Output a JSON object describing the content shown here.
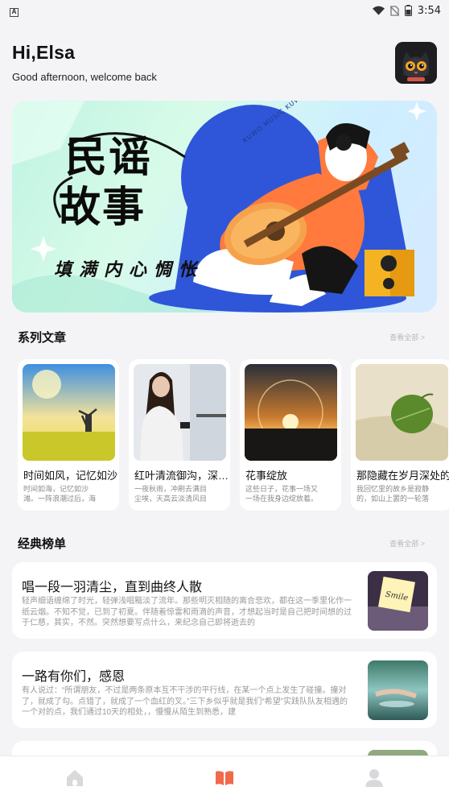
{
  "status_bar": {
    "time": "3:54",
    "notification_icon": "A"
  },
  "header": {
    "greeting": "Hi,Elsa",
    "subtitle": "Good afternoon, welcome back",
    "avatar_icon": "cat-avatar-icon"
  },
  "banner": {
    "title_line1": "民谣",
    "title_line2": "故事",
    "tagline": "填满内心惆怅",
    "ring_text": "KUWO MUSIC  KUWO MUSIC",
    "colors": {
      "bg_start": "#bff3e2",
      "bg_end": "#d7e9ff",
      "shirt": "#ff7a3c",
      "accent_blue": "#2f56d8"
    }
  },
  "series": {
    "title": "系列文章",
    "more": "查看全部 >",
    "items": [
      {
        "title": "时间如风，记忆如沙",
        "desc": "时间如海，记忆如沙滩。一阵浪潮过后，海"
      },
      {
        "title": "红叶清流御沟，深宫尽日闲",
        "desc": "一夜秋雨，冲刷去满目尘埃，天高云淡清风目"
      },
      {
        "title": "花事绽放",
        "desc": "这些日子，花事一场又一场在我身边绽放着。"
      },
      {
        "title": "那隐藏在岁月深处的",
        "desc": "我回忆里的故乡是寂静的，如山上罢的一轮落"
      }
    ]
  },
  "classics": {
    "title": "经典榜单",
    "more": "查看全部 >",
    "items": [
      {
        "title": "唱一段一羽清尘，直到曲终人散",
        "desc": "轻声细语缠绵了时光，轻弹浅唱黯淡了流年。那些明灭相随的离合悲欢，都在这一季里化作一纸云烟。不知不觉，已到了初夏。伴随着惊雷和雨滴的声音，才想起当时是自己把时间想的过于仁慈，其实，不然。突然想要写点什么，来纪念自己即将逝去的"
      },
      {
        "title": "一路有你们，感恩",
        "desc": "有人说过：“所谓朋友，不过是两条原本互不干涉的平行线，在某一个点上发生了碰撞。撞对了，就成了勾。点错了，就成了一个血红的叉。”三下乡似乎就是我们“希望”实践队队友相遇的一个对的点，我们通过10天的相处，，慢慢从陌生到熟悉，建"
      },
      {
        "title": "",
        "desc": ""
      }
    ]
  },
  "tabbar": {
    "tabs": [
      {
        "icon": "home-icon",
        "active": false
      },
      {
        "icon": "book-icon",
        "active": true
      },
      {
        "icon": "profile-icon",
        "active": false
      }
    ],
    "active_color": "#f06a4a",
    "inactive_color": "#d9d9dc"
  }
}
